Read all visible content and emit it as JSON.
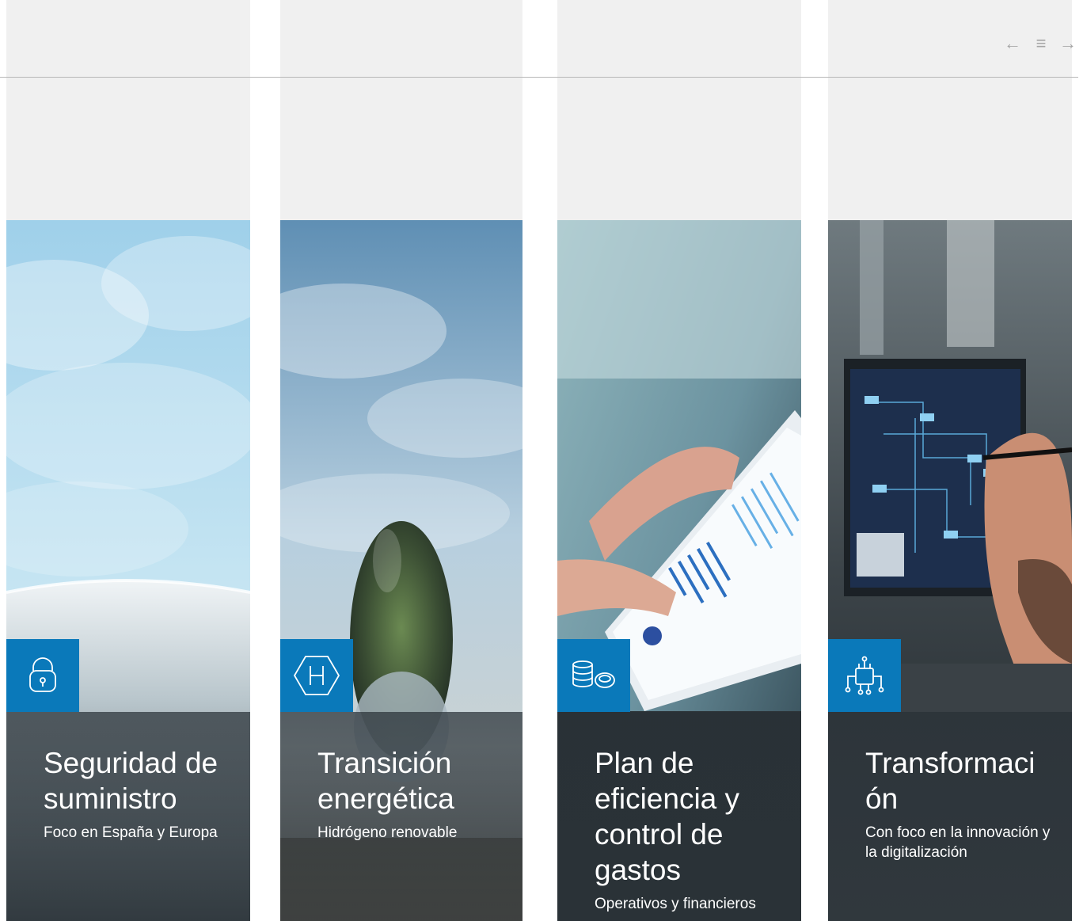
{
  "nav": {
    "prev_glyph": "←",
    "menu_glyph": "≡",
    "next_glyph": "→"
  },
  "cards": [
    {
      "title": "Seguridad de suministro",
      "subtitle": "Foco en España y Europa",
      "icon": "lock-icon"
    },
    {
      "title": "Transición energética",
      "subtitle": "Hidrógeno renovable",
      "icon": "hydrogen-icon"
    },
    {
      "title": "Plan de eficiencia y control de gastos",
      "subtitle": "Operativos y financieros",
      "icon": "coins-icon"
    },
    {
      "title": "Transformación",
      "subtitle": "Con foco en la innovación y la digitalización",
      "icon": "circuit-hand-icon"
    }
  ],
  "colors": {
    "accent": "#0a79ba",
    "top_panel": "#f0f0f0",
    "overlay": "#283036",
    "nav": "#a5a5a5"
  }
}
